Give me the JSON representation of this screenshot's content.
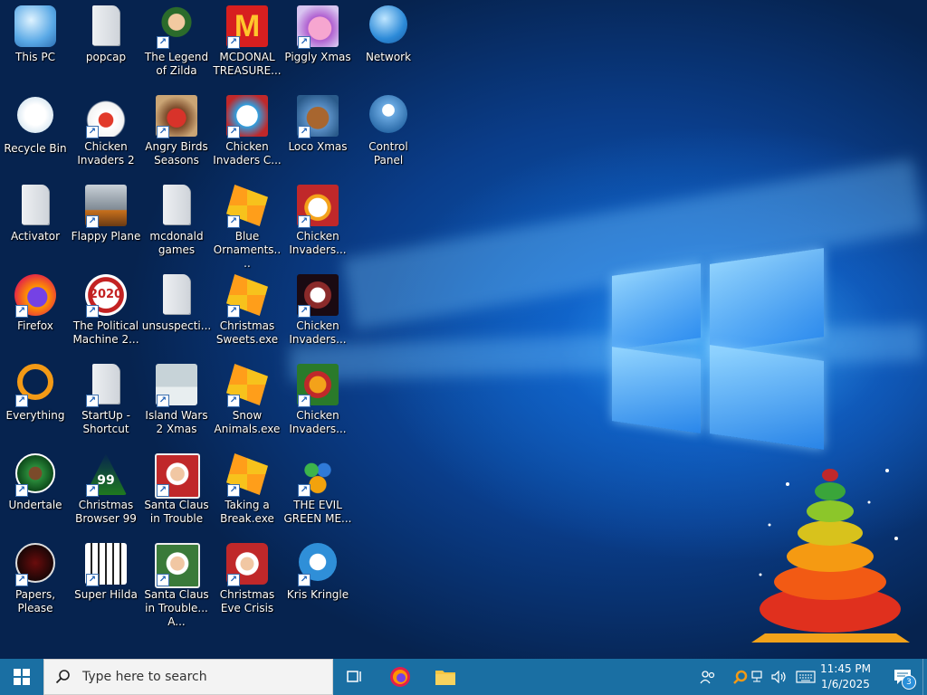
{
  "desktop": {
    "icons": [
      {
        "id": "this-pc",
        "label": "This PC",
        "shortcut": false
      },
      {
        "id": "popcap",
        "label": "popcap",
        "shortcut": false
      },
      {
        "id": "legend-of-zilda",
        "label": "The Legend of Zilda",
        "shortcut": true
      },
      {
        "id": "mcdonal-treasure",
        "label": "MCDONAL TREASURE...",
        "shortcut": true
      },
      {
        "id": "piggly-xmas",
        "label": "Piggly Xmas",
        "shortcut": true
      },
      {
        "id": "network",
        "label": "Network",
        "shortcut": false
      },
      {
        "id": "recycle-bin",
        "label": "Recycle Bin",
        "shortcut": false
      },
      {
        "id": "chicken-invaders-2",
        "label": "Chicken Invaders 2",
        "shortcut": true
      },
      {
        "id": "angry-birds-seasons",
        "label": "Angry Birds Seasons",
        "shortcut": true
      },
      {
        "id": "chicken-invaders-c",
        "label": "Chicken Invaders C...",
        "shortcut": true
      },
      {
        "id": "loco-xmas",
        "label": "Loco Xmas",
        "shortcut": true
      },
      {
        "id": "control-panel",
        "label": "Control Panel",
        "shortcut": false
      },
      {
        "id": "activator",
        "label": "Activator",
        "shortcut": false
      },
      {
        "id": "flappy-plane",
        "label": "Flappy Plane",
        "shortcut": true
      },
      {
        "id": "mcdonald-games",
        "label": "mcdonald games",
        "shortcut": false
      },
      {
        "id": "blue-ornaments",
        "label": "Blue Ornaments....",
        "shortcut": true
      },
      {
        "id": "chicken-invaders-a",
        "label": "Chicken Invaders...",
        "shortcut": true
      },
      {
        "id": "firefox",
        "label": "Firefox",
        "shortcut": true
      },
      {
        "id": "political-machine",
        "label": "The Political Machine 2...",
        "shortcut": true
      },
      {
        "id": "unsuspecti",
        "label": "unsuspecti...",
        "shortcut": false
      },
      {
        "id": "christmas-sweets",
        "label": "Christmas Sweets.exe",
        "shortcut": true
      },
      {
        "id": "chicken-invaders-b",
        "label": "Chicken Invaders...",
        "shortcut": true
      },
      {
        "id": "everything",
        "label": "Everything",
        "shortcut": true
      },
      {
        "id": "startup-shortcut",
        "label": "StartUp - Shortcut",
        "shortcut": true
      },
      {
        "id": "island-wars-2",
        "label": "Island Wars 2 Xmas",
        "shortcut": true
      },
      {
        "id": "snow-animals",
        "label": "Snow Animals.exe",
        "shortcut": true
      },
      {
        "id": "chicken-invaders-d",
        "label": "Chicken Invaders...",
        "shortcut": true
      },
      {
        "id": "undertale",
        "label": "Undertale",
        "shortcut": true
      },
      {
        "id": "christmas-browser-99",
        "label": "Christmas Browser 99",
        "shortcut": true
      },
      {
        "id": "santa-claus-trouble",
        "label": "Santa Claus in Trouble",
        "shortcut": true
      },
      {
        "id": "taking-a-break",
        "label": "Taking a Break.exe",
        "shortcut": true
      },
      {
        "id": "evil-green-me",
        "label": "THE EVIL GREEN ME...",
        "shortcut": true
      },
      {
        "id": "papers-please",
        "label": "Papers, Please",
        "shortcut": true
      },
      {
        "id": "super-hilda",
        "label": "Super Hilda",
        "shortcut": true
      },
      {
        "id": "santa-claus-trouble-a",
        "label": "Santa Claus in Trouble... A...",
        "shortcut": true
      },
      {
        "id": "christmas-eve-crisis",
        "label": "Christmas Eve Crisis",
        "shortcut": true
      },
      {
        "id": "kris-kringle",
        "label": "Kris Kringle",
        "shortcut": true
      }
    ]
  },
  "taskbar": {
    "search_placeholder": "Type here to search",
    "clock_time": "11:45 PM",
    "clock_date": "1/6/2025",
    "notification_count": "3",
    "tile_texts": {
      "political": "2020",
      "browser99": "99",
      "mcd": "M"
    },
    "accent": "#1a6fa3"
  }
}
